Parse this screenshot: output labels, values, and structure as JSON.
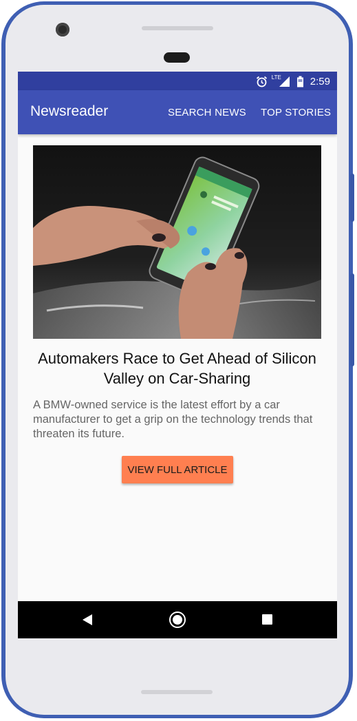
{
  "status_bar": {
    "time": "2:59",
    "network_label": "LTE",
    "icons": [
      "alarm-icon",
      "signal-icon",
      "battery-icon"
    ]
  },
  "app_bar": {
    "title": "Newsreader",
    "actions": [
      "SEARCH NEWS",
      "TOP STORIES"
    ]
  },
  "article": {
    "image": "phone-in-hands-photo",
    "headline": "Automakers Race to Get Ahead of Silicon Valley on Car-Sharing",
    "summary": "A BMW-owned service is the latest effort by a car manufacturer to get a grip on the technology trends that threaten its future.",
    "button_label": "VIEW FULL ARTICLE"
  },
  "nav_bar": {
    "icons": [
      "back-icon",
      "home-icon",
      "recents-icon"
    ]
  },
  "colors": {
    "status_bar": "#303f9f",
    "app_bar": "#3f51b5",
    "button": "#ff7f50",
    "phone_frame": "#3f5fb3"
  }
}
